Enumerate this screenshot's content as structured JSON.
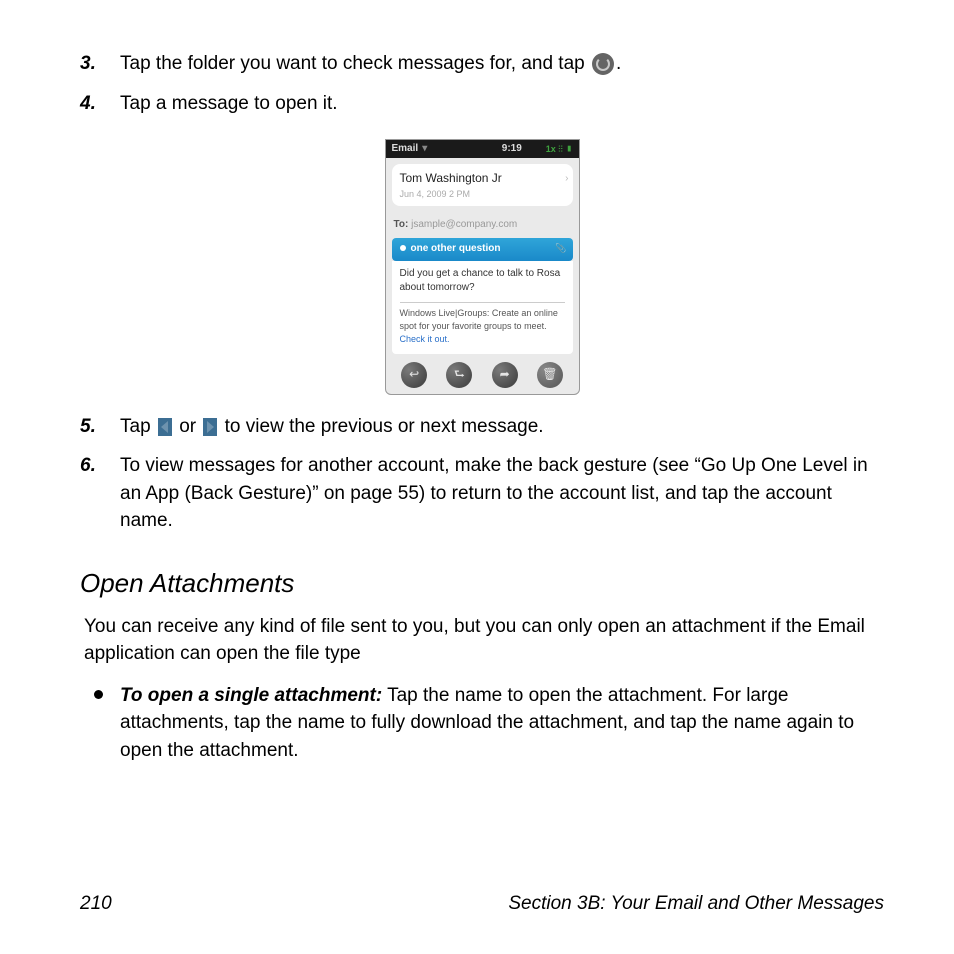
{
  "steps_a": [
    {
      "num": "3.",
      "text_before": "Tap the folder you want to check messages for, and tap ",
      "text_after": "."
    },
    {
      "num": "4.",
      "text": "Tap a message to open it."
    }
  ],
  "phone": {
    "app_label": "Email",
    "time": "9:19",
    "signal": "1x ⫶⫶ ▮",
    "from": "Tom Washington Jr",
    "from_sub": "Jun 4, 2009 2 PM",
    "to_label": "To:",
    "to_value": "jsample@company.com",
    "subject": "one other question",
    "body": "Did you get a chance to talk to Rosa about tomorrow?",
    "ad_text": "Windows Live|Groups: Create an online spot for your favorite groups to meet. ",
    "ad_link": "Check it out."
  },
  "steps_b": [
    {
      "num": "5.",
      "t1": "Tap ",
      "t2": " or ",
      "t3": " to view the previous or next message."
    },
    {
      "num": "6.",
      "text": "To view messages for another account, make the back gesture (see “Go Up One Level in an App (Back Gesture)” on page 55) to return to the account list, and tap the account name."
    }
  ],
  "open_attachments": {
    "heading": "Open Attachments",
    "lead": "You can receive any kind of file sent to you, but you can only open an attachment if the Email application can open the file type",
    "bullet_strong": "To open a single attachment:",
    "bullet_rest": " Tap the name to open the attachment. For large attachments, tap the name to fully download the attachment, and tap the name again to open the attachment."
  },
  "footer": {
    "page": "210",
    "section": "Section 3B: Your Email and Other Messages"
  }
}
